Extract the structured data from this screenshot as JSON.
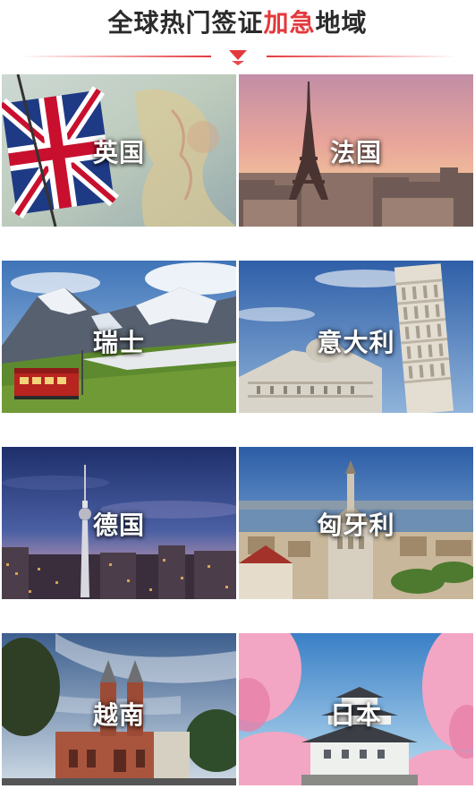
{
  "header": {
    "title_part1": "全球热门签证",
    "title_accent": "加急",
    "title_part2": "地域",
    "accent_color": "#e4393c"
  },
  "regions": [
    {
      "name": "英国"
    },
    {
      "name": "法国"
    },
    {
      "name": "瑞士"
    },
    {
      "name": "意大利"
    },
    {
      "name": "德国"
    },
    {
      "name": "匈牙利"
    },
    {
      "name": "越南"
    },
    {
      "name": "日本"
    }
  ]
}
